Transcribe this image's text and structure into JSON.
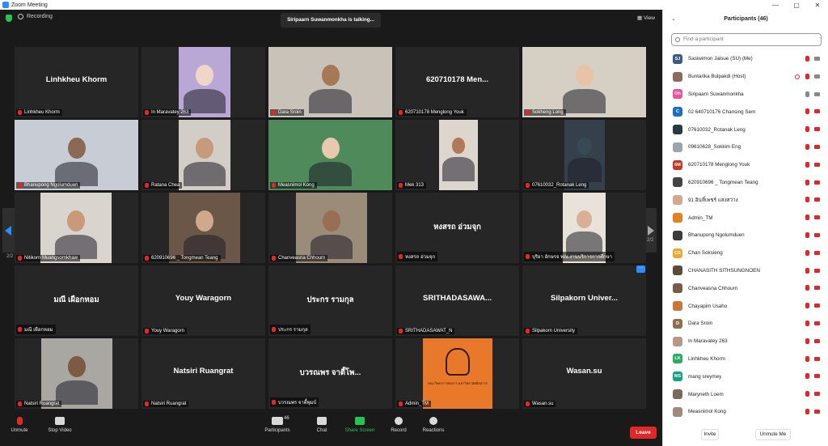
{
  "window": {
    "title": "Zoom Meeting",
    "min": "—",
    "max": "▢",
    "close": "✕"
  },
  "meeting": {
    "recording_label": "Recording",
    "talking_text": "Siripaarn Suwanmonkha is talking...",
    "view_label": "View",
    "page_left": "2/2",
    "page_right": "2/2"
  },
  "tiles": [
    {
      "big": "Linhkheu Khorm",
      "label": "Linhkheu Khorm",
      "bg": "#262626"
    },
    {
      "big": "",
      "label": "In Maravatey 263",
      "bg": "#262626"
    },
    {
      "big": "",
      "label": "Dara Sroin",
      "bg": "#262626"
    },
    {
      "big": "620710178 Men...",
      "label": "620710178 Menglong Youk",
      "bg": "#262626"
    },
    {
      "big": "",
      "label": "Sokheng Long",
      "bg": "#262626"
    },
    {
      "big": "",
      "label": "Bhanupong Ngolumduen",
      "bg": "#262626"
    },
    {
      "big": "",
      "label": "Ratana Chea",
      "bg": "#262626"
    },
    {
      "big": "",
      "label": "Measnimol Kong",
      "bg": "#262626"
    },
    {
      "big": "",
      "label": "Mek 313",
      "bg": "#262626"
    },
    {
      "big": "",
      "label": "07610032_Rotanak Leng",
      "bg": "#262626"
    },
    {
      "big": "",
      "label": "Nitikorn Muangsornkhaw",
      "bg": "#262626"
    },
    {
      "big": "",
      "label": "620910696 _ Tongmean Teang",
      "bg": "#262626"
    },
    {
      "big": "",
      "label": "Chanveasna Chhourn",
      "bg": "#262626"
    },
    {
      "big": "หงสรถ อ่วมจุก",
      "label": "หงสรถ อ่วมจุก",
      "bg": "#262626"
    },
    {
      "big": "",
      "label": "บุริยา อักษรจ พณ.งานบริการการศึกษา",
      "bg": "#262626"
    },
    {
      "big": "มณี เผือกหอม",
      "label": "มณี เผือกหอม",
      "bg": "#262626"
    },
    {
      "big": "Youy Waragorn",
      "label": "Youy Waragorn",
      "bg": "#262626"
    },
    {
      "big": "ประกร รามกุล",
      "label": "ประกร รามกุล",
      "bg": "#262626"
    },
    {
      "big": "SRITHADASAWA...",
      "label": "SRITHADASAWAT_N",
      "bg": "#262626"
    },
    {
      "big": "Silpakorn Univer...",
      "label": "Silpakorn University",
      "bg": "#262626"
    },
    {
      "big": "",
      "label": "Natsiri Ruangrat",
      "bg": "#262626"
    },
    {
      "big": "Natsiri Ruangrat",
      "label": "Natsiri Ruangrat",
      "bg": "#262626"
    },
    {
      "big": "บวรณพร จาตี้โพ...",
      "label": "บวรณพร จาตี้พุมบ์",
      "bg": "#262626"
    },
    {
      "big": "",
      "label": "Admin_TM",
      "bg": "#262626"
    },
    {
      "big": "Wasan.su",
      "label": "Wasan.su",
      "bg": "#262626"
    }
  ],
  "admin_logo_text": "คณะวิทยาการจัดการ มหาวิทยาลัยศิลปากร",
  "toolbar": {
    "unmute": "Unmute",
    "stop_video": "Stop Video",
    "participants": "Participants",
    "participants_count": "46",
    "chat": "Chat",
    "share_screen": "Share Screen",
    "record": "Record",
    "reactions": "Reactions",
    "leave": "Leave"
  },
  "panel": {
    "title": "Participants (46)",
    "search_placeholder": "Find a participant",
    "invite": "Invite",
    "unmute_me": "Unmute Me",
    "participants": [
      {
        "name": "Sasiwimon Jaisue (SU) (Me)",
        "avatar": "SJ",
        "color": "#3d5a80",
        "mic": "muted",
        "cam": "on"
      },
      {
        "name": "Buntarika Bulpakdi (Host)",
        "avatar": "",
        "color": "#8a6d5a",
        "mic": "muted",
        "cam": "on"
      },
      {
        "name": "Siripaarn Suwanmonkha",
        "avatar": "Oh",
        "color": "#e6559a",
        "mic": "on",
        "cam": "on"
      },
      {
        "name": "02 640710176 Chansing Sem",
        "avatar": "C",
        "color": "#1e6fc4",
        "mic": "muted",
        "cam": "muted"
      },
      {
        "name": "07610032_Rotanak Leng",
        "avatar": "",
        "color": "#2a3a44",
        "mic": "muted",
        "cam": "muted"
      },
      {
        "name": "09610628_Sokkim Eng",
        "avatar": "",
        "color": "#9aa5ad",
        "mic": "muted",
        "cam": "muted"
      },
      {
        "name": "620710178 Menglong Youk",
        "avatar": "6M",
        "color": "#c0392b",
        "mic": "muted",
        "cam": "muted"
      },
      {
        "name": "620910696 _ Tongmean Teang",
        "avatar": "",
        "color": "#444",
        "mic": "muted",
        "cam": "muted"
      },
      {
        "name": "91 อินทิ์เพชร์ แสงสว่าง",
        "avatar": "",
        "color": "#d4a88c",
        "mic": "muted",
        "cam": "muted"
      },
      {
        "name": "Admin_TM",
        "avatar": "",
        "color": "#e67e22",
        "mic": "muted",
        "cam": "muted"
      },
      {
        "name": "Bhanupong Ngolumduen",
        "avatar": "",
        "color": "#3c3c3c",
        "mic": "muted",
        "cam": "muted"
      },
      {
        "name": "Chan Soksieng",
        "avatar": "CS",
        "color": "#f0a830",
        "mic": "muted",
        "cam": "muted"
      },
      {
        "name": "CHANASITH SITHSUNGNOEN",
        "avatar": "",
        "color": "#5a4a3a",
        "mic": "muted",
        "cam": "muted"
      },
      {
        "name": "Chanveasna Chhourn",
        "avatar": "",
        "color": "#7a5a4a",
        "mic": "muted",
        "cam": "muted"
      },
      {
        "name": "Chayapim Usaho",
        "avatar": "",
        "color": "#c8763a",
        "mic": "muted",
        "cam": "muted"
      },
      {
        "name": "Dara Sroin",
        "avatar": "D",
        "color": "#8e6e50",
        "mic": "muted",
        "cam": "muted"
      },
      {
        "name": "In Maravatey 263",
        "avatar": "",
        "color": "#b59a8a",
        "mic": "muted",
        "cam": "muted"
      },
      {
        "name": "Linhkheu Khorm",
        "avatar": "LK",
        "color": "#27ae60",
        "mic": "muted",
        "cam": "muted"
      },
      {
        "name": "mang sreymey",
        "avatar": "MS",
        "color": "#16a085",
        "mic": "muted",
        "cam": "muted"
      },
      {
        "name": "Maryneth Loem",
        "avatar": "",
        "color": "#7a6a5a",
        "mic": "muted",
        "cam": "muted"
      },
      {
        "name": "Measnimol Kong",
        "avatar": "",
        "color": "#a08a7a",
        "mic": "muted",
        "cam": "muted"
      }
    ]
  },
  "colors": {
    "leave": "#e02828",
    "muted": "#e02828",
    "share": "#23c552",
    "accent": "#2d8cff"
  }
}
